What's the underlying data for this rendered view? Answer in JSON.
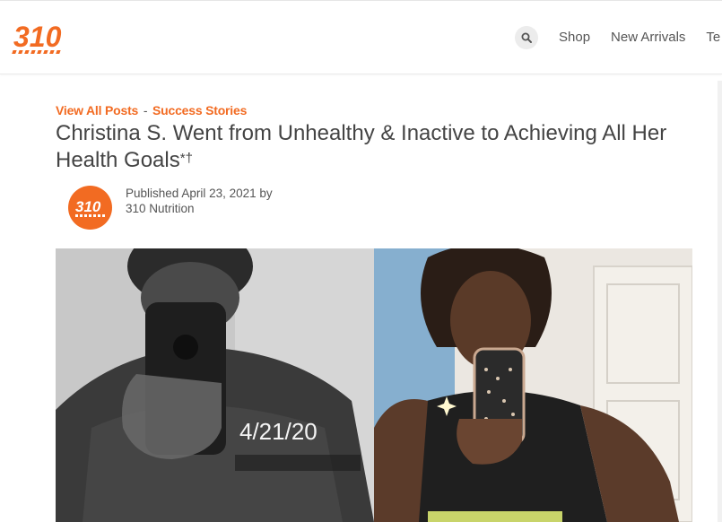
{
  "header": {
    "logo_text": "310",
    "nav": [
      "Shop",
      "New Arrivals",
      "Te"
    ]
  },
  "breadcrumb": {
    "all_posts": "View All Posts",
    "separator": "-",
    "category": "Success Stories"
  },
  "post": {
    "title": "Christina S. Went from Unhealthy & Inactive to Achieving All Her Health Goals",
    "title_marks": "*†",
    "published_label": "Published",
    "date": "April 23, 2021",
    "by_label": "by",
    "author": "310 Nutrition",
    "avatar_text": "310"
  },
  "photos": {
    "left_date_stamp": "4/21/20"
  },
  "colors": {
    "accent": "#f26b22",
    "title": "#444444",
    "nav": "#555555"
  }
}
